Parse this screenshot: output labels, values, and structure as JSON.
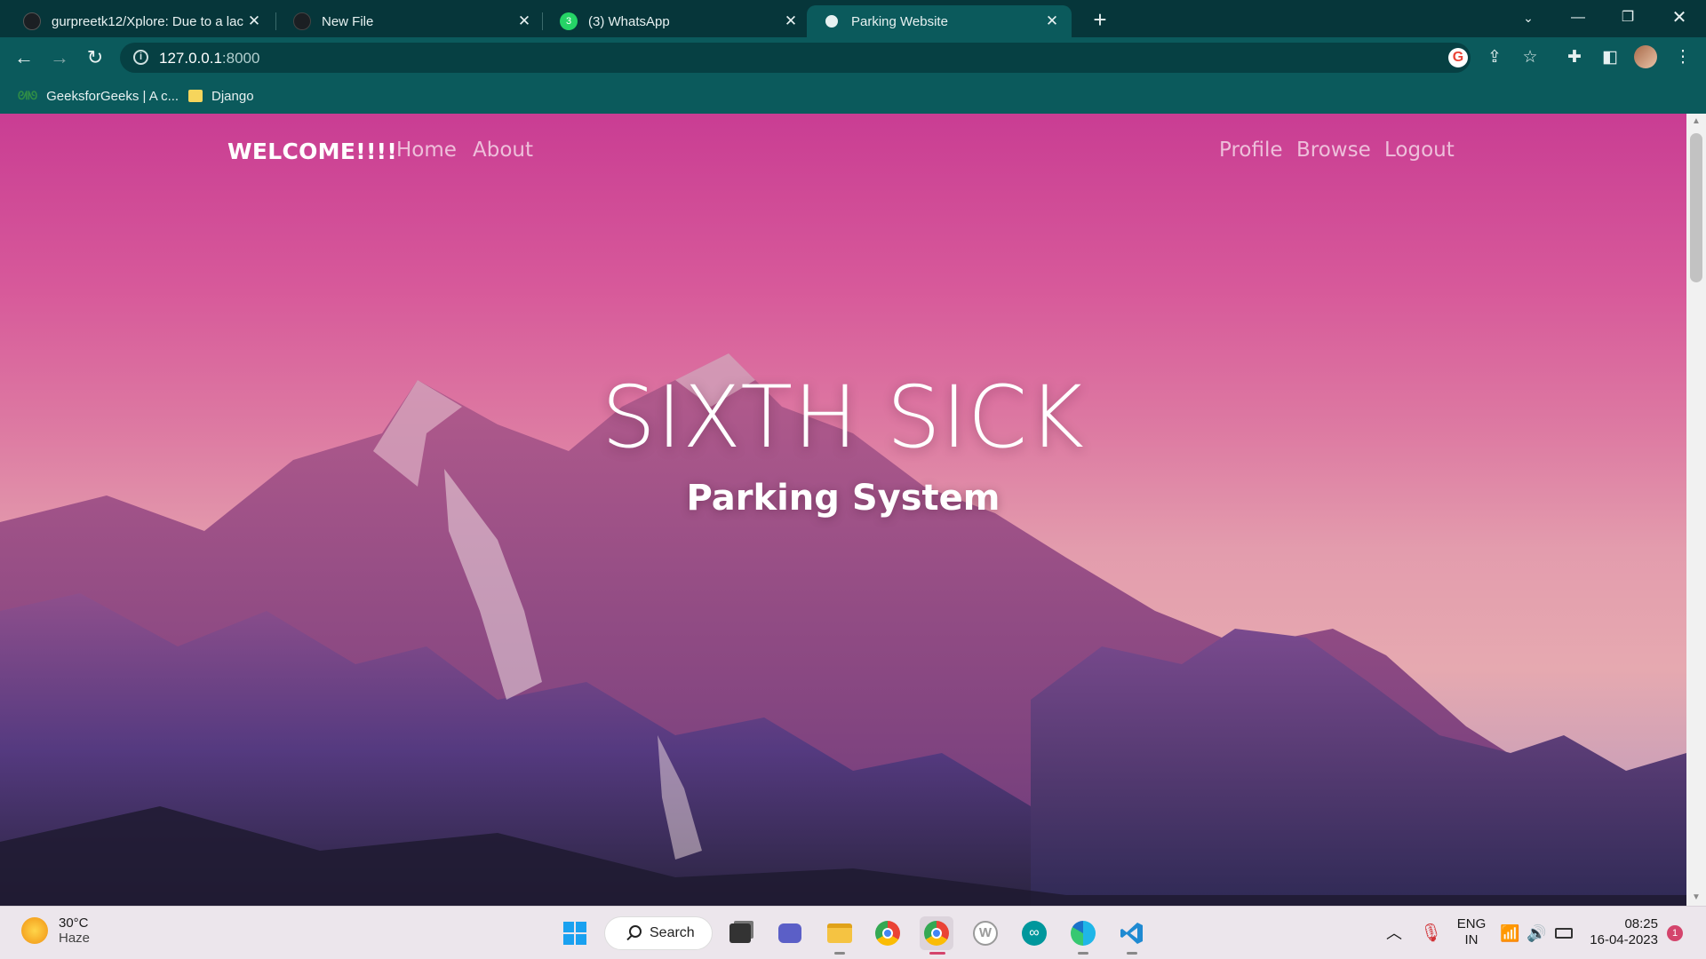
{
  "browser": {
    "tabs": [
      {
        "title": "gurpreetk12/Xplore: Due to a lac",
        "active": false
      },
      {
        "title": "New File",
        "active": false
      },
      {
        "title": "(3) WhatsApp",
        "active": false
      },
      {
        "title": "Parking Website",
        "active": true
      }
    ],
    "url_host": "127.0.0.1",
    "url_port": ":8000",
    "bookmarks": [
      {
        "label": "GeeksforGeeks | A c..."
      },
      {
        "label": "Django"
      }
    ]
  },
  "site": {
    "brand": "WELCOME!!!!",
    "nav_left": [
      "Home",
      "About"
    ],
    "nav_right": [
      "Profile",
      "Browse",
      "Logout"
    ],
    "hero_title": "SIXTH SICK",
    "hero_subtitle": "Parking System"
  },
  "taskbar": {
    "weather_temp": "30°C",
    "weather_condition": "Haze",
    "search_label": "Search",
    "language": "ENG",
    "region": "IN",
    "time": "08:25",
    "date": "16-04-2023",
    "notification_count": "1"
  },
  "colors": {
    "chrome_dark": "#06363a",
    "chrome_toolbar": "#0b5a5c",
    "sky_top": "#c93d93",
    "taskbar_bg": "#ece6ec"
  }
}
